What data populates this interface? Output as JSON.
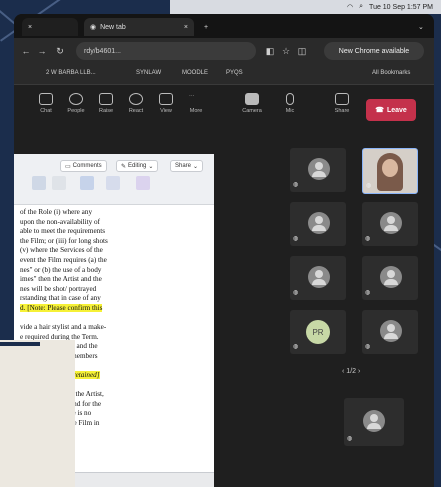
{
  "menubar": {
    "datetime": "Tue 10 Sep 1:57 PM"
  },
  "tabs": [
    {
      "label": "New tab"
    }
  ],
  "address": {
    "url": "rdy/b4601..."
  },
  "chrome_update": {
    "label": "New Chrome available"
  },
  "bookmarks": {
    "items": [
      "2 W BARBA LLB...",
      "SYNLAW",
      "MOODLE",
      "PYQS"
    ],
    "all_label": "All Bookmarks"
  },
  "meeting_toolbar": {
    "buttons": [
      "Chat",
      "People",
      "Raise",
      "React",
      "View",
      "More",
      "Camera",
      "Mic",
      "Share"
    ],
    "leave_label": "Leave"
  },
  "document": {
    "ribbon": {
      "comments": "Comments",
      "editing": "Editing",
      "share": "Share"
    },
    "lines": [
      {
        "text": "of the Role (i) where any",
        "style": ""
      },
      {
        "text": "upon the non-availability of",
        "style": ""
      },
      {
        "text": "able to meet the requirements",
        "style": ""
      },
      {
        "text": "the Film; or (iii) for long shots",
        "style": ""
      },
      {
        "text": "(v) where the Services of the",
        "style": ""
      },
      {
        "text": "event the Film requires (a) the",
        "style": ""
      },
      {
        "text": "nes\" or (b) the use of a body",
        "style": ""
      },
      {
        "text": "imes\" then the Artist and the",
        "style": ""
      },
      {
        "text": "nes will be shot/ portrayed",
        "style": ""
      },
      {
        "text": "rstanding that in case of any",
        "style": ""
      },
      {
        "text": "d. [Note: Please confirm this",
        "style": "hl"
      },
      {
        "text": "",
        "style": ""
      },
      {
        "text": "vide a hair stylist and a make-",
        "style": ""
      },
      {
        "text": "e required during the Term.",
        "style": ""
      },
      {
        "text": "any staff members, and the",
        "style": ""
      },
      {
        "text": "towards any staff members",
        "style": ""
      },
      {
        "text": "",
        "style": ""
      },
      {
        "text": "if this words to be retained]",
        "style": "hl it"
      },
      {
        "text": "",
        "style": ""
      },
      {
        "text": "e prior approval of the Artist,",
        "style": ""
      },
      {
        "text": "ships in the Film and for the",
        "style": ""
      },
      {
        "text": "hereof, where there is no",
        "style": ""
      },
      {
        "text": "and the Artist in the Film in",
        "style": ""
      }
    ]
  },
  "gallery": {
    "tiles": [
      {
        "kind": "avatar",
        "name": ""
      },
      {
        "kind": "video",
        "name": ""
      },
      {
        "kind": "avatar",
        "name": ""
      },
      {
        "kind": "avatar",
        "name": ""
      },
      {
        "kind": "avatar",
        "name": ""
      },
      {
        "kind": "avatar",
        "name": ""
      },
      {
        "kind": "initials",
        "initials": "PR",
        "name": ""
      },
      {
        "kind": "avatar",
        "name": ""
      },
      {
        "kind": "avatar",
        "name": "Prof. T..."
      },
      {
        "kind": "avatar",
        "name": ""
      }
    ],
    "pager": "1/2",
    "self_tile": {
      "name": ""
    }
  },
  "colors": {
    "leave": "#c4314b",
    "highlight": "#f6f137",
    "wallpaper": "#1b2d4c"
  }
}
